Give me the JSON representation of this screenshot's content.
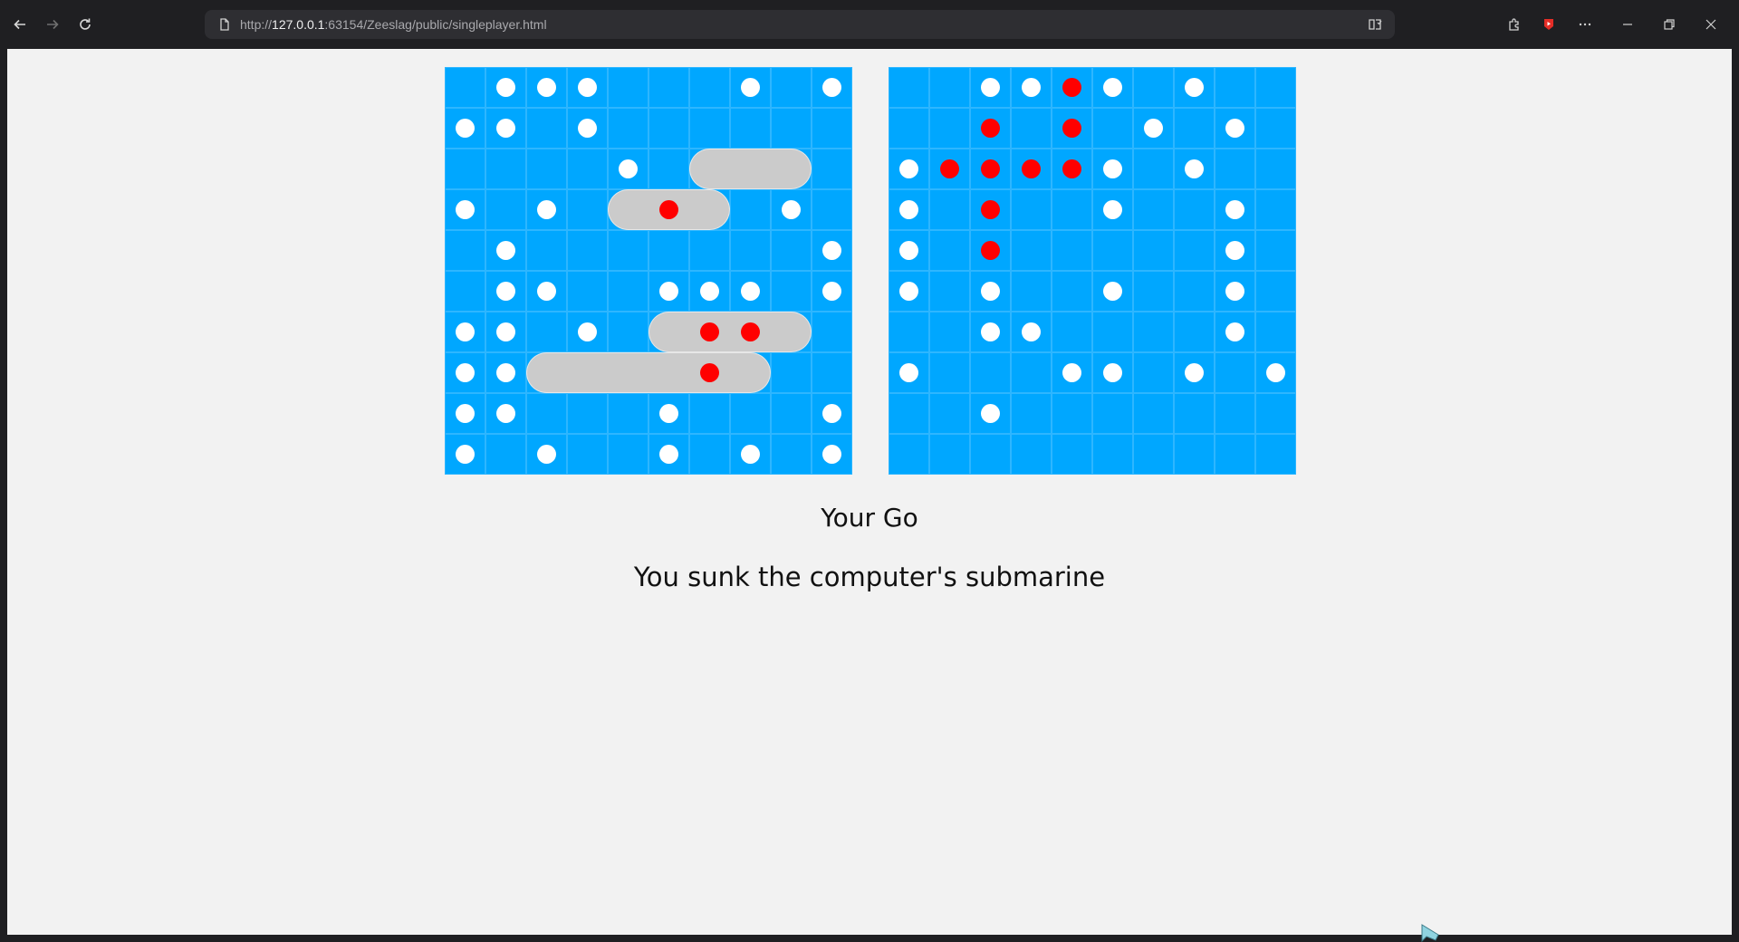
{
  "browser": {
    "url_prefix": "http://",
    "url_host": "127.0.0.1",
    "url_rest": ":63154/Zeeslag/public/singleplayer.html",
    "icons": {
      "back": "back-arrow-icon",
      "forward": "forward-arrow-icon",
      "reload": "reload-icon",
      "page": "page-icon",
      "reader": "reading-view-icon",
      "extensions": "extensions-icon",
      "youtube": "youtube-icon",
      "more": "more-icon",
      "minimize": "minimize-icon",
      "restore": "restore-icon",
      "close": "close-icon"
    }
  },
  "game": {
    "colors": {
      "water": "#00a7ff",
      "ship": "#cbcbcb",
      "hit": "#ff0000",
      "miss": "#ffffff"
    },
    "player_board": {
      "ships": [
        {
          "row": 2,
          "col": 6,
          "length": 3,
          "orientation": "horizontal"
        },
        {
          "row": 3,
          "col": 4,
          "length": 3,
          "orientation": "horizontal"
        },
        {
          "row": 6,
          "col": 5,
          "length": 4,
          "orientation": "horizontal"
        },
        {
          "row": 7,
          "col": 2,
          "length": 6,
          "orientation": "horizontal"
        }
      ],
      "hits": [
        [
          3,
          5
        ],
        [
          6,
          6
        ],
        [
          6,
          7
        ],
        [
          7,
          6
        ]
      ],
      "misses": [
        [
          0,
          1
        ],
        [
          0,
          2
        ],
        [
          0,
          3
        ],
        [
          0,
          7
        ],
        [
          0,
          9
        ],
        [
          1,
          0
        ],
        [
          1,
          1
        ],
        [
          1,
          3
        ],
        [
          2,
          4
        ],
        [
          3,
          0
        ],
        [
          3,
          2
        ],
        [
          3,
          8
        ],
        [
          4,
          1
        ],
        [
          4,
          9
        ],
        [
          5,
          1
        ],
        [
          5,
          2
        ],
        [
          5,
          5
        ],
        [
          5,
          6
        ],
        [
          5,
          7
        ],
        [
          5,
          9
        ],
        [
          6,
          0
        ],
        [
          6,
          1
        ],
        [
          6,
          3
        ],
        [
          7,
          0
        ],
        [
          7,
          1
        ],
        [
          8,
          0
        ],
        [
          8,
          1
        ],
        [
          8,
          5
        ],
        [
          8,
          9
        ],
        [
          9,
          0
        ],
        [
          9,
          2
        ],
        [
          9,
          5
        ],
        [
          9,
          7
        ],
        [
          9,
          9
        ]
      ]
    },
    "computer_board": {
      "hits": [
        [
          0,
          4
        ],
        [
          1,
          2
        ],
        [
          1,
          4
        ],
        [
          2,
          1
        ],
        [
          2,
          2
        ],
        [
          2,
          3
        ],
        [
          2,
          4
        ],
        [
          3,
          2
        ],
        [
          4,
          2
        ]
      ],
      "misses": [
        [
          0,
          2
        ],
        [
          0,
          3
        ],
        [
          0,
          5
        ],
        [
          0,
          7
        ],
        [
          1,
          6
        ],
        [
          1,
          8
        ],
        [
          2,
          0
        ],
        [
          2,
          5
        ],
        [
          2,
          7
        ],
        [
          3,
          0
        ],
        [
          3,
          5
        ],
        [
          3,
          8
        ],
        [
          4,
          0
        ],
        [
          4,
          8
        ],
        [
          5,
          0
        ],
        [
          5,
          2
        ],
        [
          5,
          5
        ],
        [
          5,
          8
        ],
        [
          6,
          2
        ],
        [
          6,
          3
        ],
        [
          6,
          8
        ],
        [
          7,
          0
        ],
        [
          7,
          4
        ],
        [
          7,
          5
        ],
        [
          7,
          7
        ],
        [
          7,
          9
        ],
        [
          8,
          2
        ]
      ]
    },
    "turn_text": "Your Go",
    "info_text": "You sunk the computer's submarine"
  }
}
